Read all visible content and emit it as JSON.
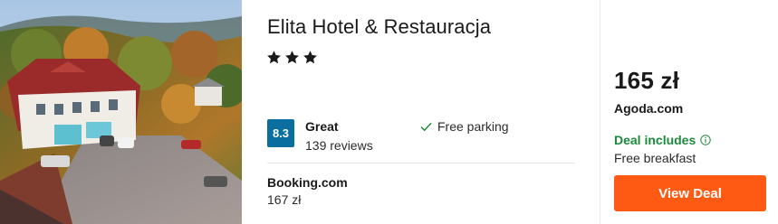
{
  "hotel": {
    "name": "Elita Hotel & Restauracja",
    "star_count": 3,
    "star_icon": "star-icon"
  },
  "rating": {
    "score": "8.3",
    "label": "Great",
    "reviews": "139 reviews",
    "badge_color": "#0a6f9e"
  },
  "amenity": {
    "icon": "check-icon",
    "label": "Free parking"
  },
  "alt_offer": {
    "provider": "Booking.com",
    "price": "167 zł"
  },
  "deal": {
    "price": "165 zł",
    "provider": "Agoda.com",
    "includes_label": "Deal includes",
    "includes_icon": "info-icon",
    "perk": "Free breakfast",
    "button_label": "View Deal",
    "button_color": "#ff5a14",
    "includes_color": "#1b8a3b"
  }
}
